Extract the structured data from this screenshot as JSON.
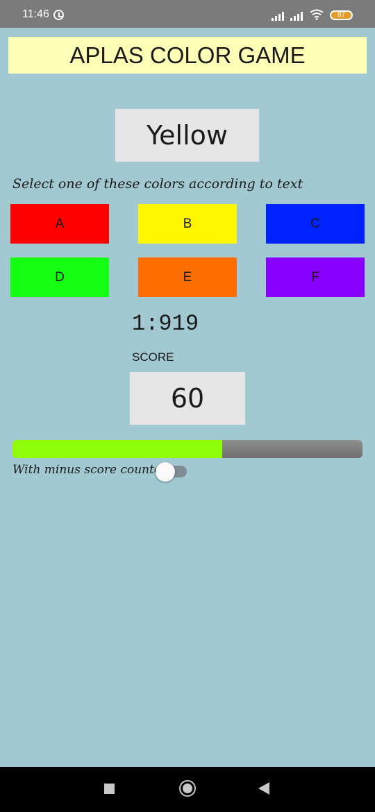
{
  "status_bar": {
    "time": "11:46",
    "battery": "87",
    "icons": [
      "alarm-icon",
      "signal-icon",
      "signal-icon",
      "wifi-icon",
      "battery-icon"
    ]
  },
  "header": {
    "title": "APLAS COLOR GAME",
    "background": "#feffb6"
  },
  "game": {
    "target_word": "Yellow",
    "instruction": "Select one of these colors according to text",
    "buttons": [
      {
        "label": "A",
        "color": "#ff0000"
      },
      {
        "label": "B",
        "color": "#fff700"
      },
      {
        "label": "C",
        "color": "#0022ff"
      },
      {
        "label": "D",
        "color": "#14ff14"
      },
      {
        "label": "E",
        "color": "#ff6e00"
      },
      {
        "label": "F",
        "color": "#8800ff"
      }
    ],
    "timer": "1:919",
    "score_label": "SCORE",
    "score": "60",
    "progress": 0.6,
    "progress_color": "#8ffc0a",
    "toggle_label": "With minus score counter",
    "toggle_on": false
  },
  "nav_bar": {
    "icons": [
      "recent-apps-icon",
      "home-icon",
      "back-icon"
    ]
  }
}
